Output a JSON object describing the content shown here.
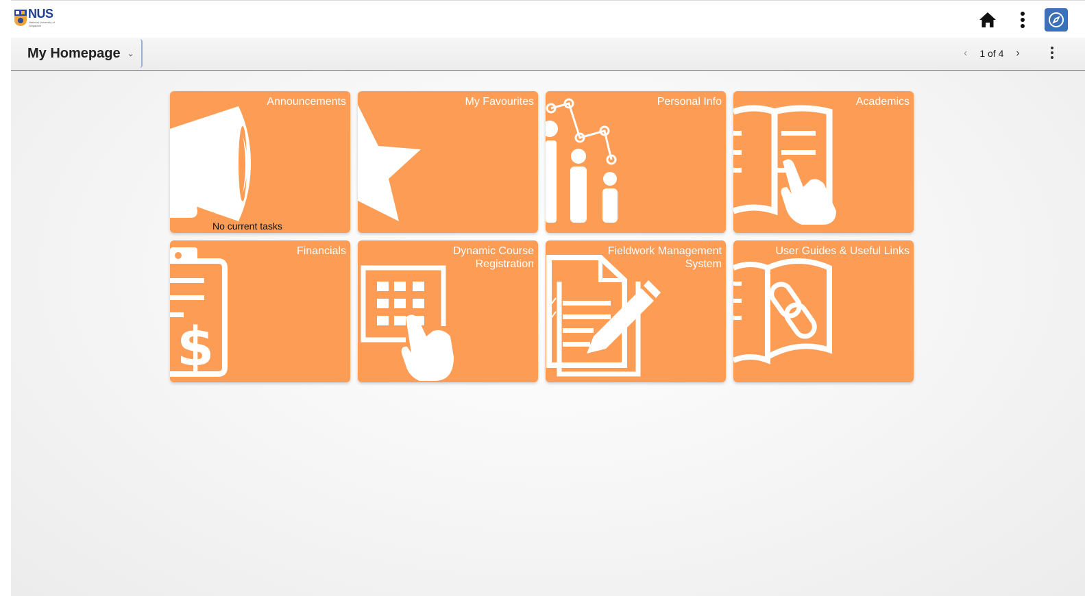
{
  "brand": {
    "name": "NUS",
    "subtitle": "National University of Singapore"
  },
  "header": {
    "home_label": "Home",
    "actions_label": "Actions",
    "navigator_label": "NavBar"
  },
  "page": {
    "title": "My Homepage",
    "pager_text": "1 of 4"
  },
  "tiles": [
    {
      "label": "Announcements",
      "note": "No current tasks"
    },
    {
      "label": "My Favourites"
    },
    {
      "label": "Personal Info"
    },
    {
      "label": "Academics"
    },
    {
      "label": "Financials"
    },
    {
      "label": "Dynamic Course Registration"
    },
    {
      "label": "Fieldwork Management System"
    },
    {
      "label": "User Guides & Useful Links"
    }
  ],
  "colors": {
    "tile": "#fd9c54",
    "nav_button": "#3b6fb6",
    "brand": "#1f3f8f"
  }
}
